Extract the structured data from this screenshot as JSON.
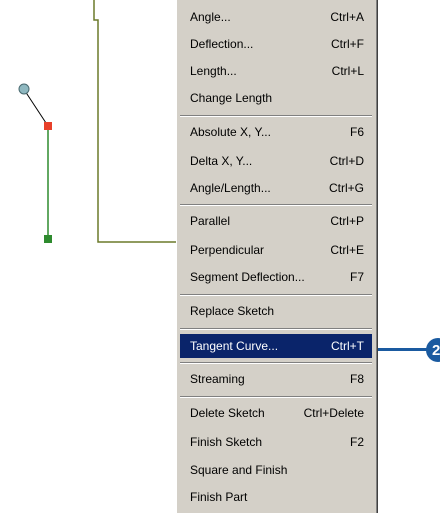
{
  "menu": {
    "items": [
      {
        "label": "Angle...",
        "shortcut": "Ctrl+A"
      },
      {
        "label": "Deflection...",
        "shortcut": "Ctrl+F"
      },
      {
        "label": "Length...",
        "shortcut": "Ctrl+L"
      },
      {
        "label": "Change Length",
        "shortcut": ""
      },
      {
        "label": "Absolute X, Y...",
        "shortcut": "F6"
      },
      {
        "label": "Delta X, Y...",
        "shortcut": "Ctrl+D"
      },
      {
        "label": "Angle/Length...",
        "shortcut": "Ctrl+G"
      },
      {
        "label": "Parallel",
        "shortcut": "Ctrl+P"
      },
      {
        "label": "Perpendicular",
        "shortcut": "Ctrl+E"
      },
      {
        "label": "Segment Deflection...",
        "shortcut": "F7"
      },
      {
        "label": "Replace Sketch",
        "shortcut": ""
      },
      {
        "label": "Tangent Curve...",
        "shortcut": "Ctrl+T"
      },
      {
        "label": "Streaming",
        "shortcut": "F8"
      },
      {
        "label": "Delete Sketch",
        "shortcut": "Ctrl+Delete"
      },
      {
        "label": "Finish Sketch",
        "shortcut": "F2"
      },
      {
        "label": "Square and Finish",
        "shortcut": ""
      },
      {
        "label": "Finish Part",
        "shortcut": ""
      }
    ],
    "selected_label": "Tangent Curve..."
  },
  "callout": {
    "number": "2",
    "color": "#1a5aa0"
  },
  "sketch": {
    "line_color": "#2e8b2e",
    "vertex_color": "#2e8b2e",
    "current_vertex_color": "#e8402a",
    "snap_circle_color": "#8fb8c0",
    "background_line_color": "#6b7a2a"
  }
}
